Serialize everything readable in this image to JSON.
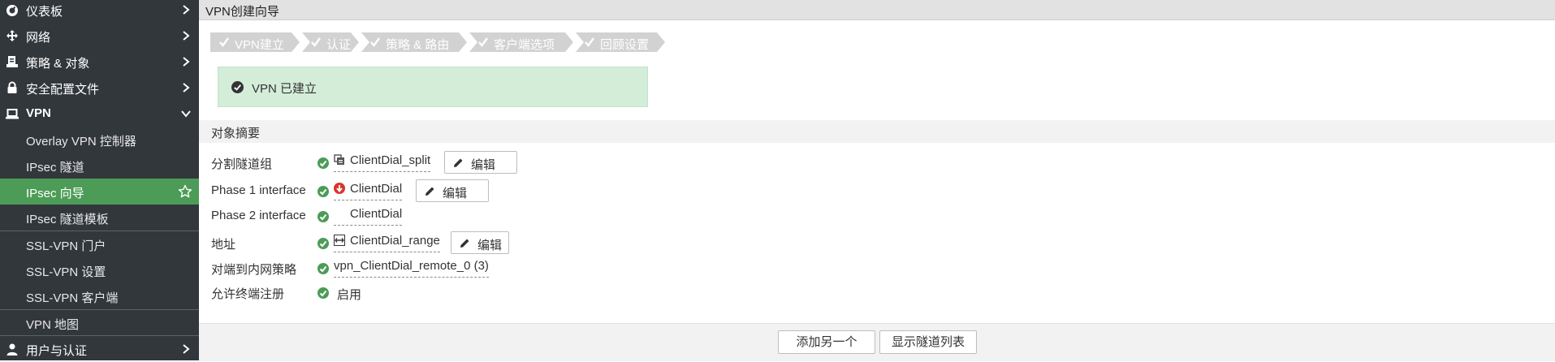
{
  "sidebar": {
    "items": [
      {
        "label": "仪表板",
        "icon": "dashboard-icon"
      },
      {
        "label": "网络",
        "icon": "network-icon"
      },
      {
        "label": "策略 & 对象",
        "icon": "policy-icon"
      },
      {
        "label": "安全配置文件",
        "icon": "lock-icon"
      },
      {
        "label": "VPN",
        "icon": "laptop-icon"
      }
    ],
    "vpn_sub": [
      {
        "label": "Overlay VPN 控制器"
      },
      {
        "label": "IPsec 隧道"
      },
      {
        "label": "IPsec 向导"
      },
      {
        "label": "IPsec 隧道模板"
      },
      {
        "label": "SSL-VPN 门户"
      },
      {
        "label": "SSL-VPN 设置"
      },
      {
        "label": "SSL-VPN 客户端"
      },
      {
        "label": "VPN 地图"
      }
    ],
    "bottom_item": {
      "label": "用户与认证",
      "icon": "user-icon"
    },
    "active_sub": "IPsec 向导",
    "active_color": "#4c9c57",
    "bg_color": "#32373c"
  },
  "page": {
    "title": "VPN创建向导"
  },
  "steps": [
    {
      "label": "VPN建立"
    },
    {
      "label": "认证"
    },
    {
      "label": "策略 & 路由"
    },
    {
      "label": "客户端选项"
    },
    {
      "label": "回顾设置"
    }
  ],
  "success": {
    "message": "VPN 已建立",
    "icon": "check-circle-icon",
    "bg_color": "#d4edd9"
  },
  "summary": {
    "heading": "对象摘要",
    "rows": [
      {
        "key": "分割隧道组",
        "value": "ClientDial_split",
        "icon": "address-group-icon",
        "edit": "编辑"
      },
      {
        "key": "Phase 1 interface",
        "value": "ClientDial",
        "icon": "tunnel-down-icon",
        "edit": "编辑"
      },
      {
        "key": "Phase 2 interface",
        "value": "ClientDial"
      },
      {
        "key": "地址",
        "value": "ClientDial_range",
        "icon": "address-range-icon",
        "edit": "编辑"
      },
      {
        "key": "对端到内网策略",
        "value": "vpn_ClientDial_remote_0 (3)"
      },
      {
        "key": "允许终端注册",
        "value": "启用"
      }
    ]
  },
  "footer": {
    "add_another": "添加另一个",
    "show_tunnels": "显示隧道列表"
  }
}
